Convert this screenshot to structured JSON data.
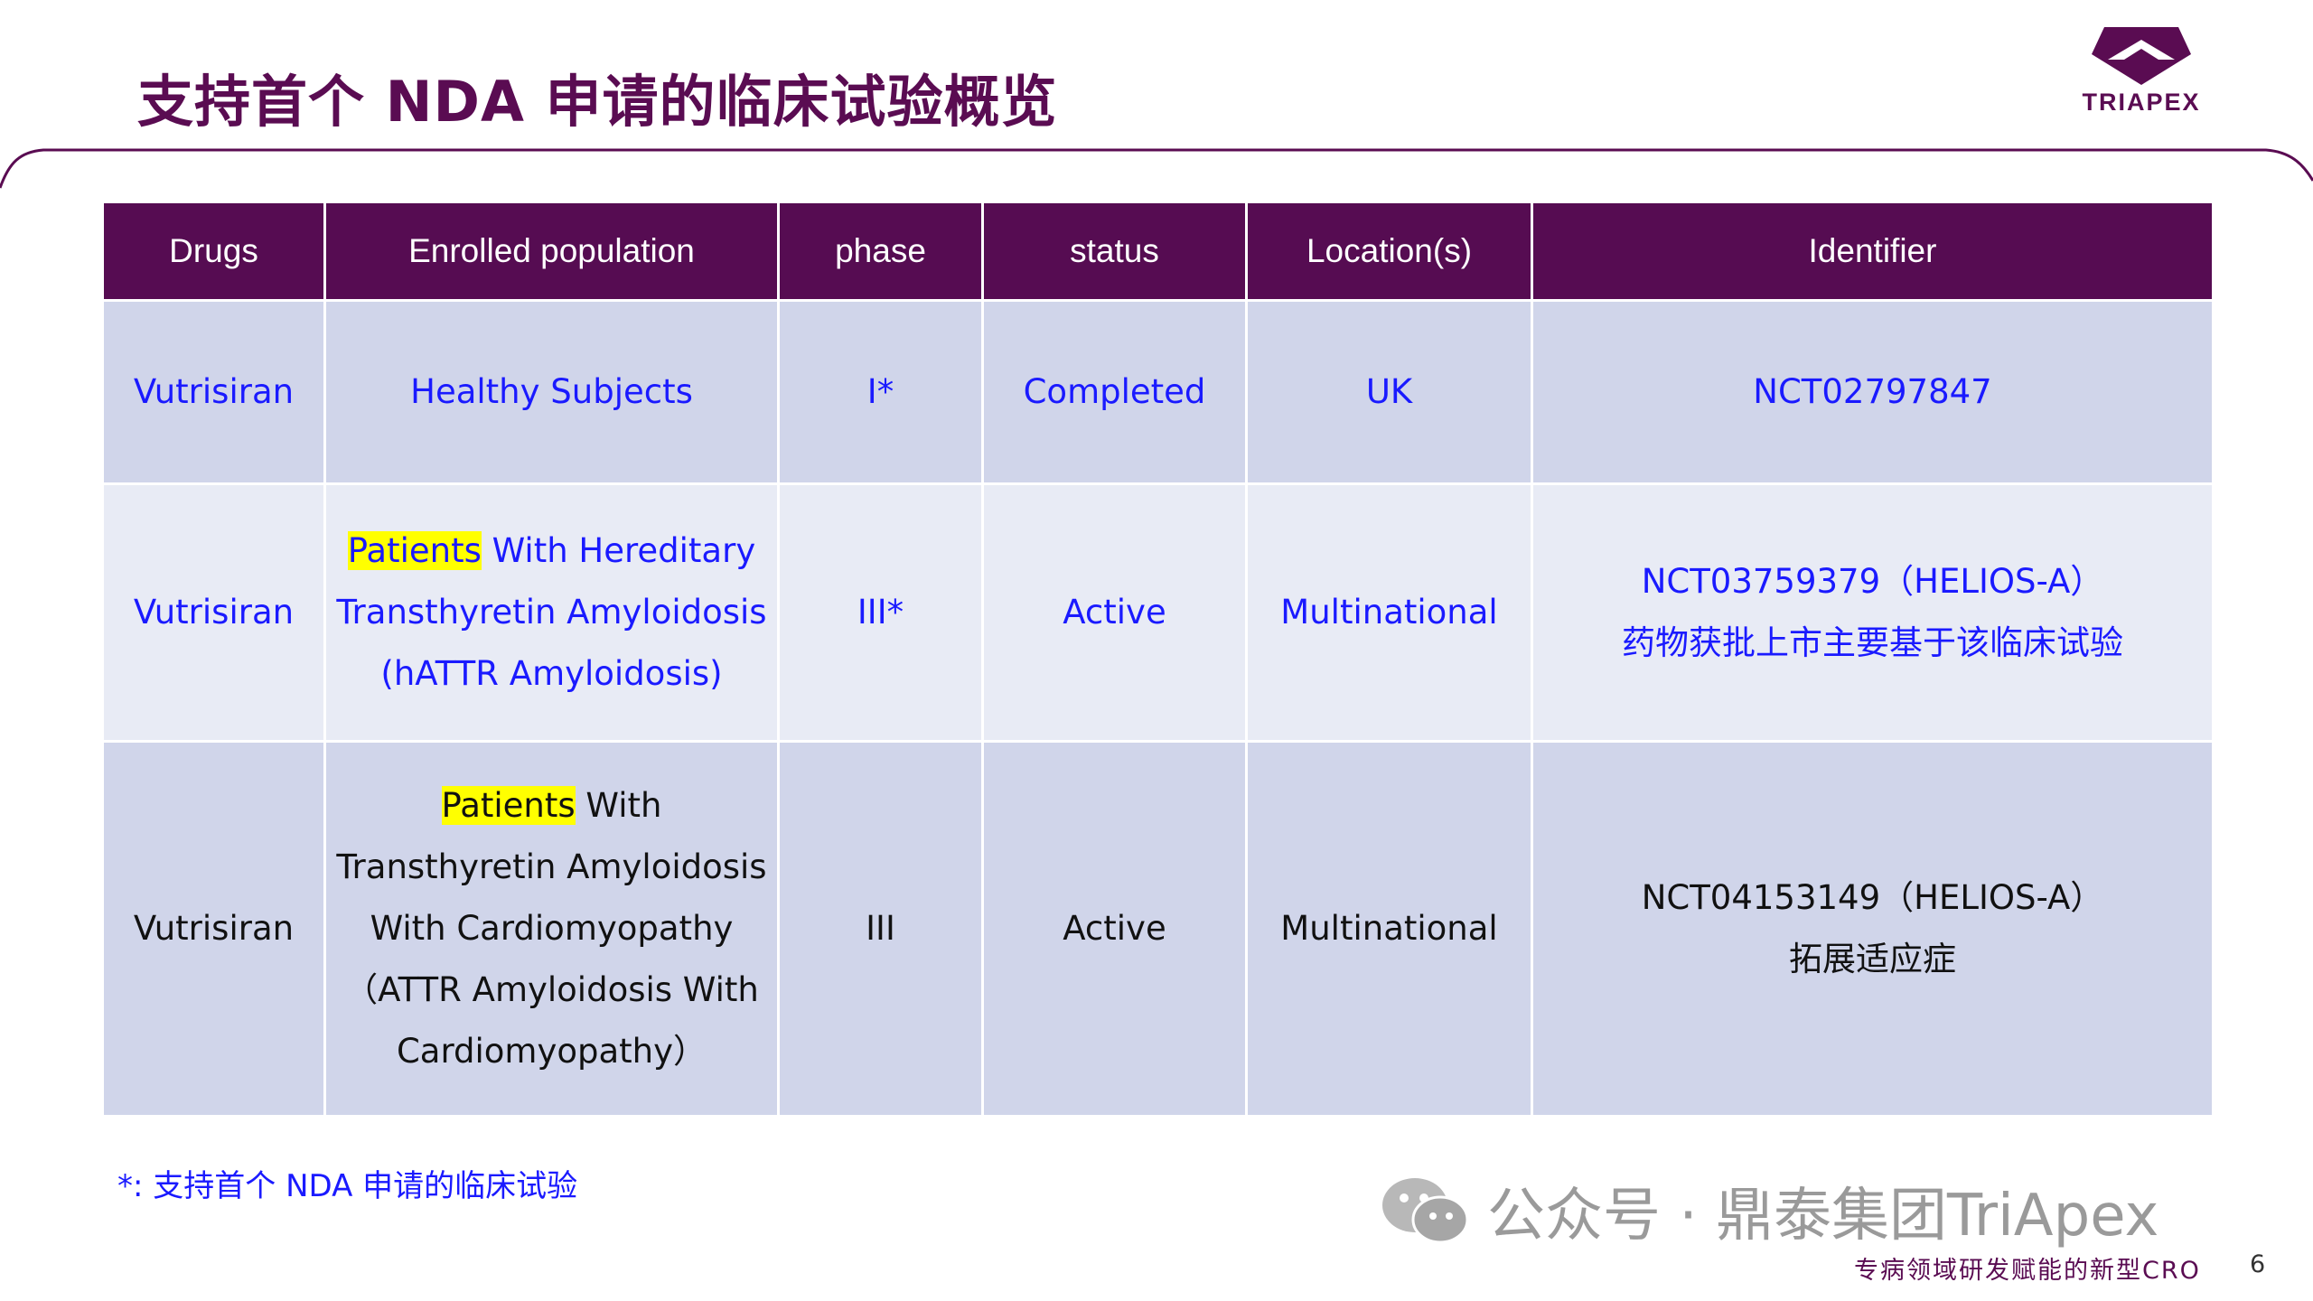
{
  "slide": {
    "title": "支持首个 NDA 申请的临床试验概览",
    "logo_text": "TRIAPEX",
    "footnote": "*:  支持首个 NDA 申请的临床试验",
    "watermark": "公众号 · 鼎泰集团TriApex",
    "tagline": "专病领域研发赋能的新型CRO",
    "page_number": "6"
  },
  "table": {
    "headers": [
      "Drugs",
      "Enrolled population",
      "phase",
      "status",
      "Location(s)",
      "Identifier"
    ],
    "rows": [
      {
        "drug": "Vutrisiran",
        "population_highlight": "",
        "population_lines": [
          "Healthy Subjects"
        ],
        "phase": "I*",
        "status": "Completed",
        "location": "UK",
        "identifier": "NCT02797847",
        "identifier_note": ""
      },
      {
        "drug": "Vutrisiran",
        "population_highlight": "Patients",
        "population_lines": [
          " With Hereditary",
          "Transthyretin Amyloidosis",
          "(hATTR Amyloidosis)"
        ],
        "phase": "III*",
        "status": "Active",
        "location": "Multinational",
        "identifier": "NCT03759379（HELIOS-A）",
        "identifier_note": "药物获批上市主要基于该临床试验"
      },
      {
        "drug": "Vutrisiran",
        "population_highlight": "Patients",
        "population_lines": [
          " With",
          "Transthyretin Amyloidosis",
          "With Cardiomyopathy",
          "（ATTR Amyloidosis With",
          "Cardiomyopathy）"
        ],
        "phase": "III",
        "status": "Active",
        "location": "Multinational",
        "identifier": "NCT04153149（HELIOS-A）",
        "identifier_note": "拓展适应症"
      }
    ]
  },
  "colors": {
    "brand": "#5a0c52",
    "header_bg": "#560c52",
    "row_alt_1": "#d0d5ea",
    "row_alt_2": "#e8ebf5",
    "link_text": "#1a1aff",
    "highlight": "#ffff00"
  },
  "icons": {
    "logo": "triapex-logo-icon",
    "watermark": "wechat-icon"
  }
}
